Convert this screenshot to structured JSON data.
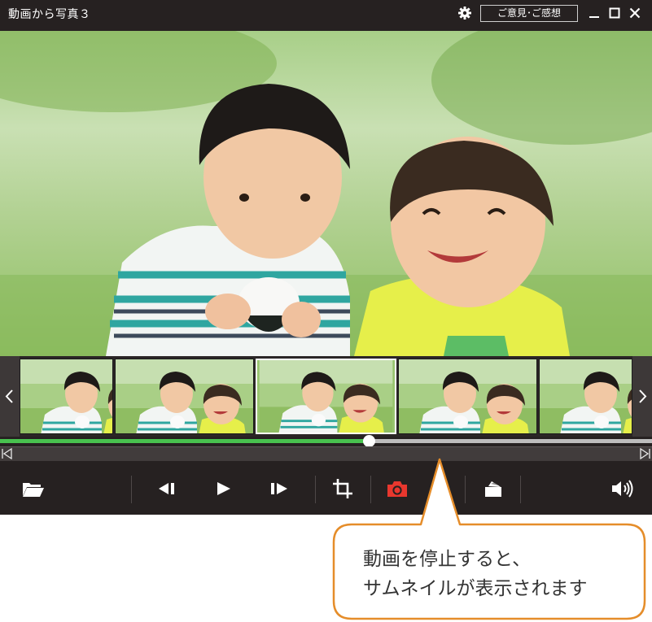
{
  "app": {
    "title": "動画から写真３",
    "feedback_label": "ご意見･ご感想",
    "icons": [
      "gear-icon",
      "minimize-icon",
      "maximize-icon",
      "close-icon"
    ]
  },
  "filmstrip": {
    "thumbnail_count": 5,
    "selected_index": 2,
    "icons": [
      "chevron-left-icon",
      "chevron-right-icon"
    ]
  },
  "playback": {
    "progress_percent": 56.5
  },
  "toolbar": {
    "icons": [
      "open-folder-icon",
      "previous-frame-icon",
      "play-icon",
      "next-frame-icon",
      "crop-icon",
      "camera-icon",
      "save-folder-icon",
      "volume-icon"
    ],
    "camera_color": "#e8372e"
  },
  "callout": {
    "line1": "動画を停止すると、",
    "line2": "サムネイルが表示されます",
    "border_color": "#e58d2a"
  },
  "colors": {
    "app_bg": "#262121",
    "progress_fill": "#48c24f",
    "track": "#bdbdbd"
  }
}
